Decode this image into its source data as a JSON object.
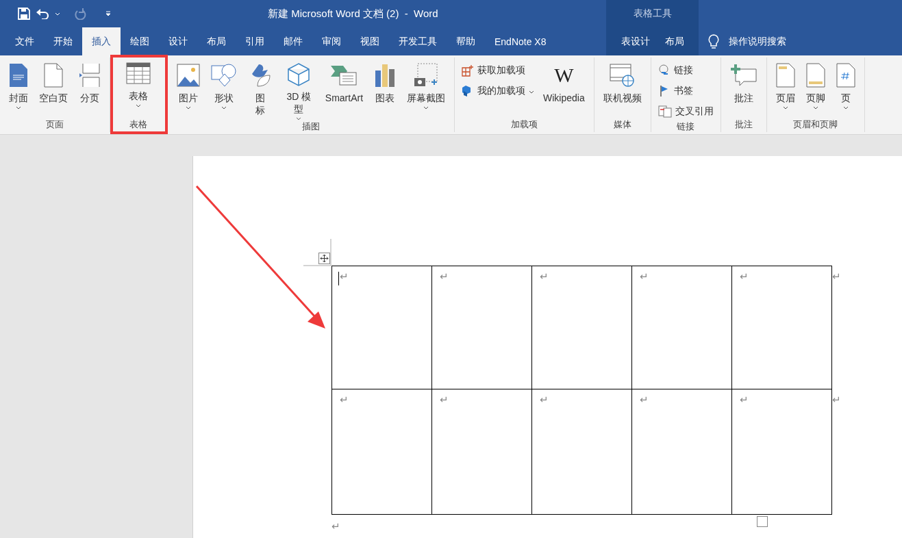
{
  "title_bar": {
    "title": "新建 Microsoft Word 文档 (2)  -  Word",
    "context_label": "表格工具"
  },
  "tabs": [
    {
      "label": "文件",
      "selected": false
    },
    {
      "label": "开始",
      "selected": false
    },
    {
      "label": "插入",
      "selected": true
    },
    {
      "label": "绘图",
      "selected": false
    },
    {
      "label": "设计",
      "selected": false
    },
    {
      "label": "布局",
      "selected": false
    },
    {
      "label": "引用",
      "selected": false
    },
    {
      "label": "邮件",
      "selected": false
    },
    {
      "label": "审阅",
      "selected": false
    },
    {
      "label": "视图",
      "selected": false
    },
    {
      "label": "开发工具",
      "selected": false
    },
    {
      "label": "帮助",
      "selected": false
    },
    {
      "label": "EndNote X8",
      "selected": false
    }
  ],
  "context_tabs": [
    {
      "label": "表设计",
      "selected": false
    },
    {
      "label": "布局",
      "selected": false
    }
  ],
  "tell_me": "操作说明搜索",
  "ribbon": [
    {
      "label": "页面",
      "highlighted": false,
      "items": [
        {
          "kind": "cover",
          "label": "封面",
          "dropdown": true
        },
        {
          "kind": "blank",
          "label": "空白页",
          "dropdown": false
        },
        {
          "kind": "break",
          "label": "分页",
          "dropdown": false
        }
      ]
    },
    {
      "label": "表格",
      "highlighted": true,
      "items": [
        {
          "kind": "table",
          "label": "表格",
          "dropdown": true
        }
      ]
    },
    {
      "label": "插图",
      "highlighted": false,
      "items": [
        {
          "kind": "picture",
          "label": "图片",
          "dropdown": true
        },
        {
          "kind": "shapes",
          "label": "形状",
          "dropdown": true
        },
        {
          "kind": "icons",
          "label": "图标",
          "dropdown": false
        },
        {
          "kind": "cube",
          "label": "3D 模型",
          "dropdown": true
        },
        {
          "kind": "smartart",
          "label": "SmartArt",
          "dropdown": false
        },
        {
          "kind": "chart",
          "label": "图表",
          "dropdown": false
        },
        {
          "kind": "screenshot",
          "label": "屏幕截图",
          "dropdown": true
        }
      ]
    },
    {
      "label": "加载项",
      "highlighted": false,
      "items": [
        {
          "stack": [
            {
              "kind": "store",
              "label": "获取加载项",
              "dropdown": false
            },
            {
              "kind": "addins",
              "label": "我的加载项",
              "dropdown": true
            }
          ]
        },
        {
          "kind": "wiki",
          "label": "Wikipedia",
          "logo_text": "W",
          "dropdown": false
        }
      ]
    },
    {
      "label": "媒体",
      "highlighted": false,
      "items": [
        {
          "kind": "video",
          "label": "联机视频",
          "dropdown": false
        }
      ]
    },
    {
      "label": "链接",
      "highlighted": false,
      "items": [
        {
          "stack": [
            {
              "kind": "link",
              "label": "链接",
              "dropdown": false
            },
            {
              "kind": "bookmark",
              "label": "书签",
              "dropdown": false
            },
            {
              "kind": "crossref",
              "label": "交叉引用",
              "dropdown": false
            }
          ]
        }
      ]
    },
    {
      "label": "批注",
      "highlighted": false,
      "items": [
        {
          "kind": "comment",
          "label": "批注",
          "dropdown": false
        }
      ]
    },
    {
      "label": "页眉和页脚",
      "highlighted": false,
      "items": [
        {
          "kind": "header",
          "label": "页眉",
          "dropdown": true
        },
        {
          "kind": "footer",
          "label": "页脚",
          "dropdown": true
        },
        {
          "kind": "pagenum",
          "label": "页",
          "dropdown": true
        }
      ]
    }
  ],
  "table": {
    "rows": [
      [
        {
          "text": "↵",
          "cursor": true
        },
        {
          "text": "↵",
          "cursor": false
        },
        {
          "text": "↵",
          "cursor": false
        },
        {
          "text": "↵",
          "cursor": false
        },
        {
          "text": "↵",
          "cursor": false
        }
      ],
      [
        {
          "text": "↵",
          "cursor": false
        },
        {
          "text": "↵",
          "cursor": false
        },
        {
          "text": "↵",
          "cursor": false
        },
        {
          "text": "↵",
          "cursor": false
        },
        {
          "text": "↵",
          "cursor": false
        }
      ]
    ],
    "row_end_marks": [
      "↵",
      "↵"
    ]
  },
  "paragraph_mark": "↵",
  "pointer_arrow": true
}
